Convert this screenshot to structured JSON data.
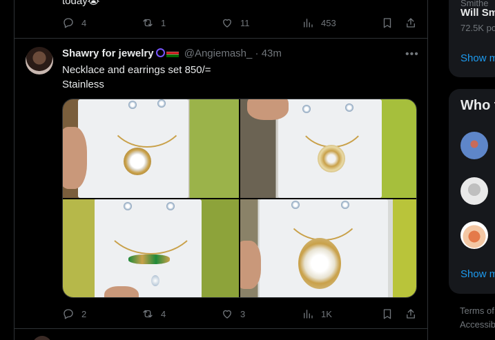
{
  "previous_tweet": {
    "text_tail": "today😭",
    "actions": {
      "replies": "4",
      "reposts": "1",
      "likes": "11",
      "views": "453"
    }
  },
  "tweet": {
    "author_name": "Shawry for jewelry",
    "handle": "@Angiemash_",
    "separator": "·",
    "time": "43m",
    "text_lines": [
      "Necklace and earrings set 850/=",
      "Stainless"
    ],
    "actions": {
      "replies": "2",
      "reposts": "4",
      "likes": "3",
      "views": "1K"
    }
  },
  "sidebar": {
    "trend_author_top": "Smithe",
    "trend_author": "Will Sm",
    "trend_posts": "72.5K po",
    "show_more_1": "Show m",
    "who_to_follow_title": "Who t",
    "show_more_2": "Show m",
    "footer_line1": "Terms of",
    "footer_line2": "Accessib"
  },
  "colors": {
    "background": "#000000",
    "text": "#e7e9ea",
    "muted": "#71767b",
    "accent": "#1d9bf0",
    "border": "#2f3336",
    "panel": "#16181c"
  },
  "icons": [
    "reply-icon",
    "repost-icon",
    "like-icon",
    "views-icon",
    "bookmark-icon",
    "share-icon",
    "more-icon"
  ]
}
